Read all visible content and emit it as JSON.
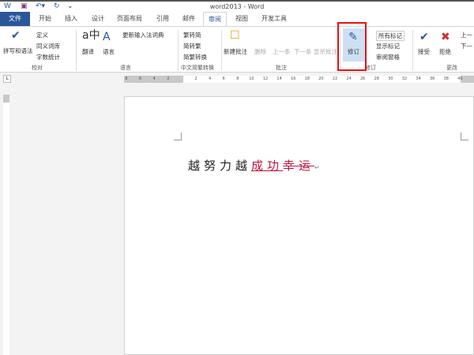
{
  "window": {
    "title": "word2013 - Word"
  },
  "quick_access": {
    "app_icon": "word-icon",
    "save_icon": "save-icon",
    "undo_icon": "undo-icon",
    "redo_icon": "redo-icon",
    "customize_icon": "customize-icon"
  },
  "tabs": [
    "文件",
    "开始",
    "插入",
    "设计",
    "页面布局",
    "引用",
    "邮件",
    "审阅",
    "视图",
    "开发工具"
  ],
  "ribbon": {
    "proofing": {
      "label": "校对",
      "spell": "拼写和语法",
      "define": "定义",
      "thesaurus": "同义词库",
      "wordcount": "字数统计"
    },
    "language": {
      "label": "语言",
      "translate": "翻译",
      "language": "语言",
      "update_ime": "更新输入法词典"
    },
    "chinese": {
      "label": "中文简繁转换",
      "to_simplified": "繁转简",
      "to_traditional": "简转繁",
      "convert": "简繁转换"
    },
    "comments": {
      "label": "批注",
      "new": "新建批注",
      "delete": "删除",
      "prev": "上一条",
      "next": "下一条",
      "show": "显示批注"
    },
    "tracking": {
      "label": "修订",
      "track": "修订",
      "markup": "所有标记",
      "show_markup": "显示标记",
      "pane": "审阅窗格"
    },
    "changes": {
      "label": "更改",
      "accept": "接受",
      "reject": "拒绝",
      "prev": "上一",
      "next": "下一"
    }
  },
  "ruler": {
    "ticks": [
      "8",
      "6",
      "4",
      "2",
      "",
      "2",
      "4",
      "6",
      "8",
      "10",
      "12",
      "14",
      "16",
      "18",
      "20",
      "22",
      "24",
      "26",
      "28",
      "30",
      "32",
      "34",
      "36",
      "38",
      "40"
    ]
  },
  "document": {
    "plain": "越努力越",
    "inserted": "成功",
    "deleted": "幸运",
    "paragraph_mark": "↵"
  },
  "colors": {
    "accent": "#2b579a",
    "revision": "#c0143c",
    "highlight_box": "#e81010"
  }
}
